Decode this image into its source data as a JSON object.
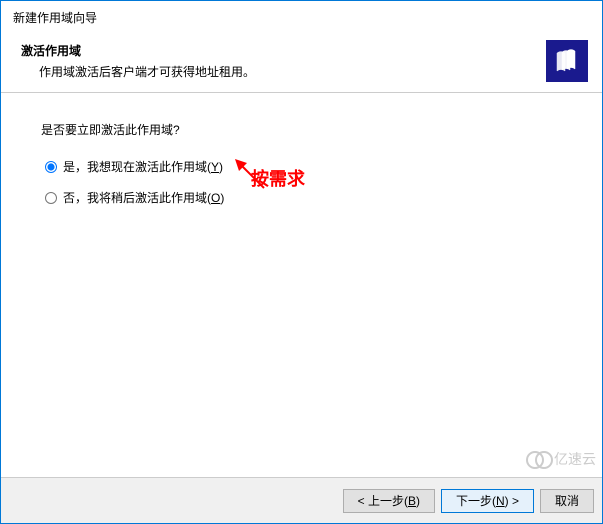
{
  "window": {
    "title": "新建作用域向导"
  },
  "header": {
    "title": "激活作用域",
    "description": "作用域激活后客户端才可获得地址租用。"
  },
  "content": {
    "question": "是否要立即激活此作用域?",
    "options": [
      {
        "label": "是，我想现在激活此作用域(",
        "hotkey": "Y",
        "suffix": ")",
        "checked": true
      },
      {
        "label": "否，我将稍后激活此作用域(",
        "hotkey": "O",
        "suffix": ")",
        "checked": false
      }
    ]
  },
  "annotation": {
    "text": "按需求"
  },
  "buttons": {
    "back": {
      "prefix": "< 上一步(",
      "hotkey": "B",
      "suffix": ")"
    },
    "next": {
      "prefix": "下一步(",
      "hotkey": "N",
      "suffix": ") >"
    },
    "cancel": {
      "label": "取消"
    }
  },
  "watermark": {
    "text": "亿速云"
  }
}
